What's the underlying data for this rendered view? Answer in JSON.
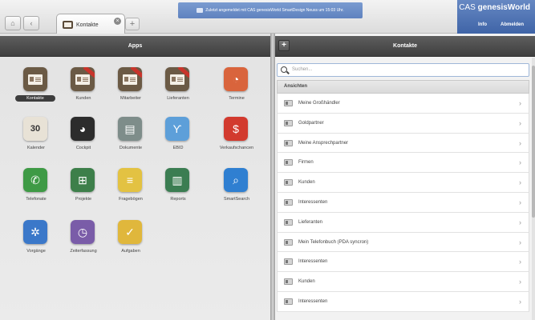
{
  "top_bar": {
    "back_glyph": "‹",
    "home_glyph": "⌂",
    "active_tab": "Kontakte",
    "add_tab_glyph": "+",
    "status_text": "Zuletzt angemeldet mit CAS genesisWorld SmartDesign Neuss um 15:03 Uhr.",
    "brand_cas": "CAS",
    "brand_genesis": "genesis",
    "brand_world": "World",
    "info_label": "Info",
    "logout_label": "Abmelden",
    "colors": {
      "brand_blue": "#4f73b4",
      "status_blue": "#6d8fc9"
    }
  },
  "apps_panel": {
    "title": "Apps",
    "apps": [
      {
        "label": "Kontakte",
        "icon": "contacts-card-icon",
        "color": "#6b5a45",
        "glyph": ""
      },
      {
        "label": "Kunden",
        "icon": "customers-card-icon",
        "color": "#6b5a45",
        "glyph": ""
      },
      {
        "label": "Mitarbeiter",
        "icon": "employees-card-icon",
        "color": "#6b5a45",
        "glyph": ""
      },
      {
        "label": "Lieferanten",
        "icon": "suppliers-card-icon",
        "color": "#6b5a45",
        "glyph": ""
      },
      {
        "label": "Termine",
        "icon": "appointments-clock-icon",
        "color": "#d9643c",
        "glyph": "◔"
      },
      {
        "label": "Kalender",
        "icon": "calendar-icon",
        "color": "#e8e2d6",
        "glyph": "30"
      },
      {
        "label": "Cockpit",
        "icon": "cockpit-pie-icon",
        "color": "#2c2c2c",
        "glyph": "◕"
      },
      {
        "label": "Dokumente",
        "icon": "documents-icon",
        "color": "#7e8d8a",
        "glyph": "▤"
      },
      {
        "label": "EBID",
        "icon": "ebid-icon",
        "color": "#5d9fd9",
        "glyph": "Ƴ"
      },
      {
        "label": "Verkaufschancen",
        "icon": "sales-chances-icon",
        "color": "#d23a2e",
        "glyph": "$"
      },
      {
        "label": "Telefonate",
        "icon": "phone-icon",
        "color": "#3e9a45",
        "glyph": "✆"
      },
      {
        "label": "Projekte",
        "icon": "projects-tree-icon",
        "color": "#3d7f4a",
        "glyph": "⊞"
      },
      {
        "label": "Fragebögen",
        "icon": "questionnaire-icon",
        "color": "#e3c242",
        "glyph": "≡"
      },
      {
        "label": "Reports",
        "icon": "reports-bars-icon",
        "color": "#3b7d52",
        "glyph": "▥"
      },
      {
        "label": "SmartSearch",
        "icon": "smartsearch-icon",
        "color": "#2f7fd1",
        "glyph": "⌕"
      },
      {
        "label": "Vorgänge",
        "icon": "processes-gear-icon",
        "color": "#3b78c9",
        "glyph": "✲"
      },
      {
        "label": "Zeiterfassung",
        "icon": "time-tracking-icon",
        "color": "#7a5ca8",
        "glyph": "◷"
      },
      {
        "label": "Aufgaben",
        "icon": "tasks-check-icon",
        "color": "#e0b73c",
        "glyph": "✓"
      }
    ]
  },
  "kontakte_panel": {
    "title": "Kontakte",
    "add_glyph": "+",
    "search_placeholder": "Suchen...",
    "list_header": "Ansichten",
    "chevron": "›",
    "items": [
      "Meine Großhändler",
      "Goldpartner",
      "Meine Ansprechpartner",
      "Firmen",
      "Kunden",
      "Interessenten",
      "Lieferanten",
      "Mein Telefonbuch (PDA syncron)",
      "Interessenten",
      "Kunden",
      "Interessenten"
    ]
  }
}
